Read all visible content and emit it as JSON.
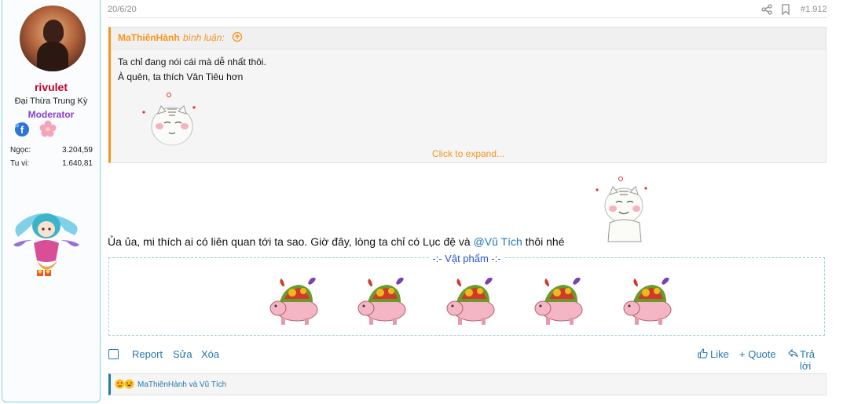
{
  "user": {
    "name": "rivulet",
    "rank": "Đại Thừa Trung Kỳ",
    "role": "Moderator",
    "stats": [
      {
        "label": "Ngọc:",
        "value": "3.204,59"
      },
      {
        "label": "Tu vi:",
        "value": "1.640,81"
      }
    ],
    "badges": [
      "facebook-badge-icon",
      "sakura-badge-icon"
    ]
  },
  "post": {
    "date": "20/6/20",
    "number": "#1.912",
    "quote": {
      "author": "MaThiênHành",
      "said": "bình luận:",
      "lines": [
        "Ta chỉ đang nói cái mà dễ nhất thôi.",
        "À quên, ta thích Vân Tiêu hơn"
      ],
      "expand": "Click to expand..."
    },
    "message": {
      "text": "Ủa ủa, mi thích ai có liên quan tới ta sao. Giờ đây, lòng ta chỉ có Lục đệ và ",
      "mention": "@Vũ Tích",
      "tail": " thôi nhé"
    },
    "items_legend": "-:- Vật phẩm -:-",
    "item_count": 5,
    "actions": {
      "report": "Report",
      "edit": "Sửa",
      "delete": "Xóa",
      "like": "Like",
      "quote": "+ Quote",
      "reply": "Trả lời"
    },
    "reactions": "MaThiênHành và Vũ Tích"
  },
  "colors": {
    "accent": "#2577b1",
    "quote_accent": "#f7941d",
    "username": "#c4002b",
    "role": "#8a3ed1"
  }
}
